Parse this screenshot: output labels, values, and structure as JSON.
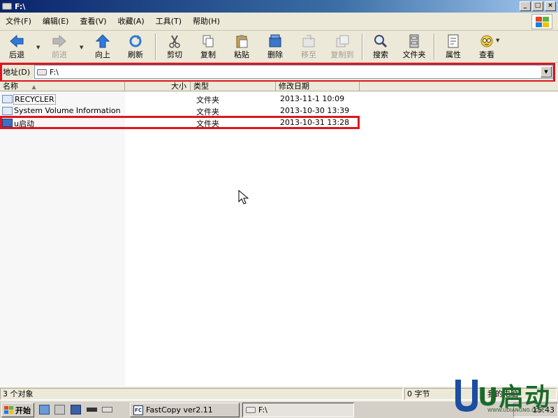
{
  "window": {
    "title": "F:\\",
    "buttons": [
      "_",
      "□",
      "×"
    ]
  },
  "menubar": {
    "items": [
      "文件(F)",
      "编辑(E)",
      "查看(V)",
      "收藏(A)",
      "工具(T)",
      "帮助(H)"
    ]
  },
  "toolbar": {
    "back": "后退",
    "forward": "前进",
    "up": "向上",
    "refresh": "刷新",
    "cut": "剪切",
    "copy": "复制",
    "paste": "粘贴",
    "delete": "删除",
    "move_to": "移至",
    "copy_to": "复制到",
    "search": "搜索",
    "folders": "文件夹",
    "properties": "属性",
    "view": "查看"
  },
  "address": {
    "label": "地址(D)",
    "value": "F:\\"
  },
  "columns": [
    "名称",
    "大小",
    "类型",
    "修改日期"
  ],
  "files": [
    {
      "name": "RECYCLER",
      "type": "文件夹",
      "modified": "2013-11-1 10:09"
    },
    {
      "name": "System Volume Information",
      "type": "文件夹",
      "modified": "2013-10-30 13:39"
    },
    {
      "name": "u启动",
      "type": "文件夹",
      "modified": "2013-10-31 13:28"
    }
  ],
  "status": {
    "count": "3 个对象",
    "size": "0 字节",
    "location": "我的电脑"
  },
  "taskbar": {
    "start": "开始",
    "tasks": [
      "FastCopy ver2.11",
      "F:\\"
    ],
    "fastcopy_icon": "FC",
    "clock": "15:43"
  },
  "watermark": {
    "text": "U启动",
    "url": "WWW.UDIANGNG.COM"
  },
  "colors": {
    "highlight": "#e0141e",
    "titlebar": "#0a246a"
  }
}
